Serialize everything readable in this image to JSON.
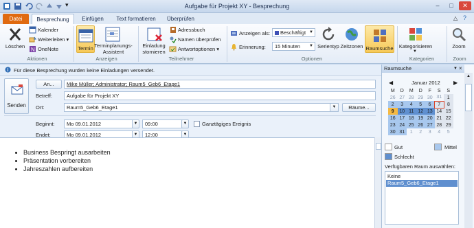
{
  "window": {
    "title": "Aufgabe für Projekt XY - Besprechung",
    "controls": [
      "–",
      "□",
      "✕"
    ]
  },
  "tabs": [
    {
      "label": "Datei",
      "id": "file"
    },
    {
      "label": "Besprechung",
      "id": "besprechung",
      "active": true
    },
    {
      "label": "Einfügen",
      "id": "einfuegen"
    },
    {
      "label": "Text formatieren",
      "id": "text"
    },
    {
      "label": "Überprüfen",
      "id": "pruefen"
    }
  ],
  "ribbon": {
    "aktionen": {
      "group_label": "Aktionen",
      "delete": "Löschen",
      "calendar": "Kalender",
      "forward": "Weiterleiten",
      "onenote": "OneNote"
    },
    "anzeigen": {
      "group_label": "Anzeigen",
      "termin": "Termin",
      "assistent_line1": "Terminplanungs-",
      "assistent_line2": "Assistent"
    },
    "teilnehmer": {
      "group_label": "Teilnehmer",
      "cancel_line1": "Einladung",
      "cancel_line2": "stornieren",
      "adressbuch": "Adressbuch",
      "namen": "Namen überprüfen",
      "antwort": "Antwortoptionen"
    },
    "optionen": {
      "group_label": "Optionen",
      "show_as_label": "Anzeigen als:",
      "show_as_value": "Beschäftigt",
      "reminder_label": "Erinnerung:",
      "reminder_value": "15 Minuten",
      "serientyp": "Serientyp",
      "zeitzonen": "Zeitzonen",
      "raumsuche": "Raumsuche"
    },
    "kategorien": {
      "group_label": "Kategorien",
      "kategorisieren": "Kategorisieren"
    },
    "zoom": {
      "group_label": "Zoom",
      "zoom": "Zoom"
    }
  },
  "infobar": {
    "text": "Für diese Besprechung wurden keine Einladungen versendet."
  },
  "form": {
    "send": "Senden",
    "to_button": "An...",
    "to_value": "Mike Müller; Administrator; Raum5_Geb6_Etage1",
    "subject_label": "Betreff:",
    "subject_value": "Aufgabe für Projekt XY",
    "location_label": "Ort:",
    "location_value": "Raum5_Geb6_Etage1",
    "rooms_button": "Räume...",
    "start_label": "Beginnt:",
    "start_date": "Mo 09.01.2012",
    "start_time": "09:00",
    "end_label": "Endet:",
    "end_date": "Mo 09.01.2012",
    "end_time": "12:00",
    "allday_label": "Ganztägiges Ereignis",
    "allday_checked": false
  },
  "body": {
    "bullets": [
      "Business Bespringt ausarbeiten",
      "Präsentation vorbereiten",
      "Jahreszahlen aufbereiten"
    ]
  },
  "roomfinder": {
    "title": "Raumsuche",
    "month": "Januar 2012",
    "weekdays": [
      "M",
      "D",
      "M",
      "D",
      "F",
      "S",
      "S"
    ],
    "weeks": [
      [
        "26",
        "27",
        "28",
        "29",
        "30",
        "31",
        "1"
      ],
      [
        "2",
        "3",
        "4",
        "5",
        "6",
        "7",
        "8"
      ],
      [
        "9",
        "10",
        "11",
        "12",
        "13",
        "14",
        "15"
      ],
      [
        "16",
        "17",
        "18",
        "19",
        "20",
        "21",
        "22"
      ],
      [
        "23",
        "24",
        "25",
        "26",
        "27",
        "28",
        "29"
      ],
      [
        "30",
        "31",
        "1",
        "2",
        "3",
        "4",
        "5"
      ]
    ],
    "legend": {
      "good": "Gut",
      "medium": "Mittel",
      "bad": "Schlecht"
    },
    "available_label": "Verfügbaren Raum auswählen:",
    "rooms": [
      "Keine",
      "Raum5_Geb6_Etage1"
    ],
    "selected_room": "Raum5_Geb6_Etage1",
    "colors": {
      "good": "#ffffff",
      "medium": "#a8c8ee",
      "bad": "#5f8fcf",
      "today": "#f5b942"
    }
  }
}
